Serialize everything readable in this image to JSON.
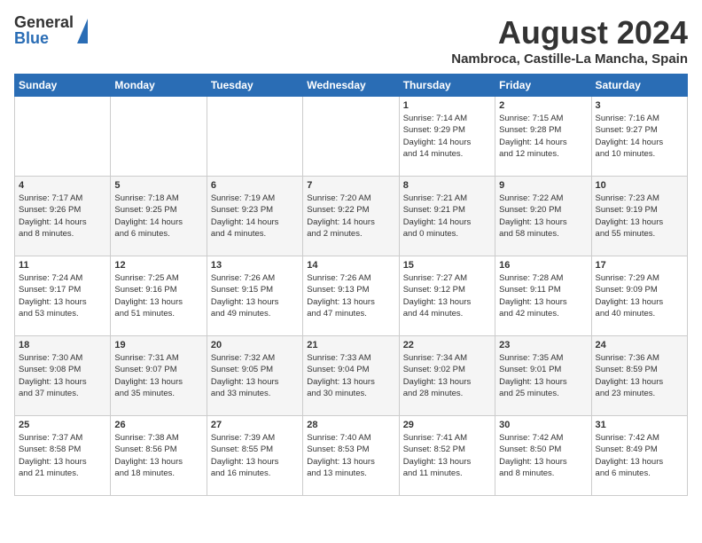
{
  "logo": {
    "line1": "General",
    "line2": "Blue"
  },
  "title": "August 2024",
  "location": "Nambroca, Castille-La Mancha, Spain",
  "weekdays": [
    "Sunday",
    "Monday",
    "Tuesday",
    "Wednesday",
    "Thursday",
    "Friday",
    "Saturday"
  ],
  "weeks": [
    [
      {
        "day": "",
        "info": ""
      },
      {
        "day": "",
        "info": ""
      },
      {
        "day": "",
        "info": ""
      },
      {
        "day": "",
        "info": ""
      },
      {
        "day": "1",
        "info": "Sunrise: 7:14 AM\nSunset: 9:29 PM\nDaylight: 14 hours\nand 14 minutes."
      },
      {
        "day": "2",
        "info": "Sunrise: 7:15 AM\nSunset: 9:28 PM\nDaylight: 14 hours\nand 12 minutes."
      },
      {
        "day": "3",
        "info": "Sunrise: 7:16 AM\nSunset: 9:27 PM\nDaylight: 14 hours\nand 10 minutes."
      }
    ],
    [
      {
        "day": "4",
        "info": "Sunrise: 7:17 AM\nSunset: 9:26 PM\nDaylight: 14 hours\nand 8 minutes."
      },
      {
        "day": "5",
        "info": "Sunrise: 7:18 AM\nSunset: 9:25 PM\nDaylight: 14 hours\nand 6 minutes."
      },
      {
        "day": "6",
        "info": "Sunrise: 7:19 AM\nSunset: 9:23 PM\nDaylight: 14 hours\nand 4 minutes."
      },
      {
        "day": "7",
        "info": "Sunrise: 7:20 AM\nSunset: 9:22 PM\nDaylight: 14 hours\nand 2 minutes."
      },
      {
        "day": "8",
        "info": "Sunrise: 7:21 AM\nSunset: 9:21 PM\nDaylight: 14 hours\nand 0 minutes."
      },
      {
        "day": "9",
        "info": "Sunrise: 7:22 AM\nSunset: 9:20 PM\nDaylight: 13 hours\nand 58 minutes."
      },
      {
        "day": "10",
        "info": "Sunrise: 7:23 AM\nSunset: 9:19 PM\nDaylight: 13 hours\nand 55 minutes."
      }
    ],
    [
      {
        "day": "11",
        "info": "Sunrise: 7:24 AM\nSunset: 9:17 PM\nDaylight: 13 hours\nand 53 minutes."
      },
      {
        "day": "12",
        "info": "Sunrise: 7:25 AM\nSunset: 9:16 PM\nDaylight: 13 hours\nand 51 minutes."
      },
      {
        "day": "13",
        "info": "Sunrise: 7:26 AM\nSunset: 9:15 PM\nDaylight: 13 hours\nand 49 minutes."
      },
      {
        "day": "14",
        "info": "Sunrise: 7:26 AM\nSunset: 9:13 PM\nDaylight: 13 hours\nand 47 minutes."
      },
      {
        "day": "15",
        "info": "Sunrise: 7:27 AM\nSunset: 9:12 PM\nDaylight: 13 hours\nand 44 minutes."
      },
      {
        "day": "16",
        "info": "Sunrise: 7:28 AM\nSunset: 9:11 PM\nDaylight: 13 hours\nand 42 minutes."
      },
      {
        "day": "17",
        "info": "Sunrise: 7:29 AM\nSunset: 9:09 PM\nDaylight: 13 hours\nand 40 minutes."
      }
    ],
    [
      {
        "day": "18",
        "info": "Sunrise: 7:30 AM\nSunset: 9:08 PM\nDaylight: 13 hours\nand 37 minutes."
      },
      {
        "day": "19",
        "info": "Sunrise: 7:31 AM\nSunset: 9:07 PM\nDaylight: 13 hours\nand 35 minutes."
      },
      {
        "day": "20",
        "info": "Sunrise: 7:32 AM\nSunset: 9:05 PM\nDaylight: 13 hours\nand 33 minutes."
      },
      {
        "day": "21",
        "info": "Sunrise: 7:33 AM\nSunset: 9:04 PM\nDaylight: 13 hours\nand 30 minutes."
      },
      {
        "day": "22",
        "info": "Sunrise: 7:34 AM\nSunset: 9:02 PM\nDaylight: 13 hours\nand 28 minutes."
      },
      {
        "day": "23",
        "info": "Sunrise: 7:35 AM\nSunset: 9:01 PM\nDaylight: 13 hours\nand 25 minutes."
      },
      {
        "day": "24",
        "info": "Sunrise: 7:36 AM\nSunset: 8:59 PM\nDaylight: 13 hours\nand 23 minutes."
      }
    ],
    [
      {
        "day": "25",
        "info": "Sunrise: 7:37 AM\nSunset: 8:58 PM\nDaylight: 13 hours\nand 21 minutes."
      },
      {
        "day": "26",
        "info": "Sunrise: 7:38 AM\nSunset: 8:56 PM\nDaylight: 13 hours\nand 18 minutes."
      },
      {
        "day": "27",
        "info": "Sunrise: 7:39 AM\nSunset: 8:55 PM\nDaylight: 13 hours\nand 16 minutes."
      },
      {
        "day": "28",
        "info": "Sunrise: 7:40 AM\nSunset: 8:53 PM\nDaylight: 13 hours\nand 13 minutes."
      },
      {
        "day": "29",
        "info": "Sunrise: 7:41 AM\nSunset: 8:52 PM\nDaylight: 13 hours\nand 11 minutes."
      },
      {
        "day": "30",
        "info": "Sunrise: 7:42 AM\nSunset: 8:50 PM\nDaylight: 13 hours\nand 8 minutes."
      },
      {
        "day": "31",
        "info": "Sunrise: 7:42 AM\nSunset: 8:49 PM\nDaylight: 13 hours\nand 6 minutes."
      }
    ]
  ]
}
